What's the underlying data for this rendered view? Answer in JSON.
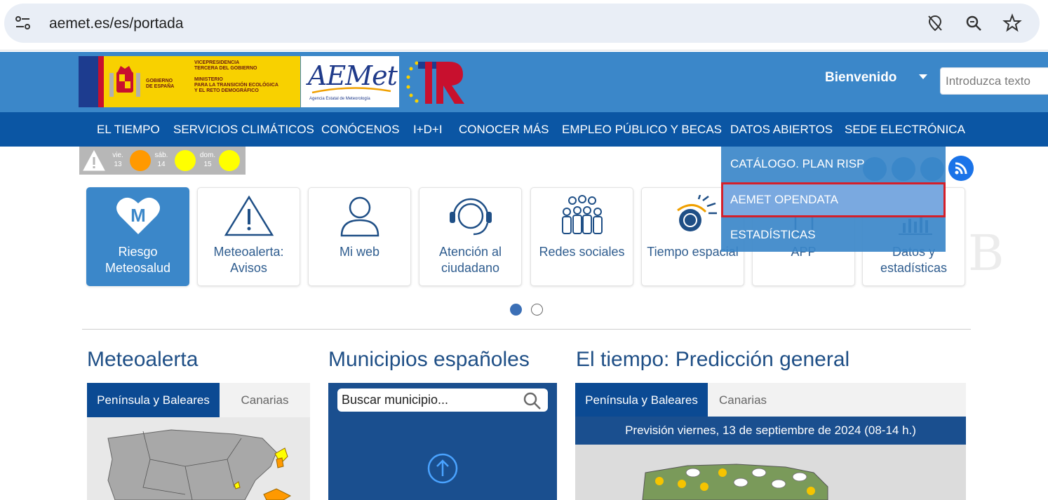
{
  "browser": {
    "url": "aemet.es/es/portada",
    "icons": [
      "site-info-icon",
      "location-blocked-icon",
      "zoom-icon",
      "bookmark-star-icon"
    ]
  },
  "header": {
    "gov_logo_text_left": "GOBIERNO\nDE ESPAÑA",
    "gov_logo_text_right": "VICEPRESIDENCIA\nTERCERA DEL GOBIERNO\n\nMINISTERIO\nPARA LA TRANSICIÓN ECOLÓGICA\nY EL RETO DEMOGRÁFICO",
    "aemet_logo_word": "AEMet",
    "aemet_logo_sub": "Agencia Estatal de Meteorología",
    "welcome": "Bienvenido",
    "search_placeholder": "Introduzca texto"
  },
  "nav": {
    "items": [
      "EL TIEMPO",
      "SERVICIOS CLIMÁTICOS",
      "CONÓCENOS",
      "I+D+I",
      "CONOCER MÁS",
      "EMPLEO PÚBLICO Y BECAS",
      "DATOS ABIERTOS",
      "SEDE ELECTRÓNICA"
    ]
  },
  "warnings": {
    "days": [
      {
        "day": "vie.",
        "num": "13",
        "color": "#ff9900"
      },
      {
        "day": "sáb.",
        "num": "14",
        "color": "#ffff00"
      },
      {
        "day": "dom.",
        "num": "15",
        "color": "#ffff00"
      }
    ]
  },
  "dropdown": {
    "items": [
      "CATÁLOGO. PLAN RISP",
      "AEMET OPENDATA",
      "ESTADÍSTICAS"
    ],
    "highlighted_index": 1
  },
  "cards": [
    {
      "label": "Riesgo Meteosalud",
      "icon": "heart-m-icon",
      "active": true
    },
    {
      "label": "Meteoalerta: Avisos",
      "icon": "warning-triangle-icon",
      "active": false
    },
    {
      "label": "Mi web",
      "icon": "user-icon",
      "active": false
    },
    {
      "label": "Atención al ciudadano",
      "icon": "headset-icon",
      "active": false
    },
    {
      "label": "Redes sociales",
      "icon": "people-group-icon",
      "active": false
    },
    {
      "label": "Tiempo espacial",
      "icon": "space-weather-icon",
      "active": false
    },
    {
      "label": "APP",
      "icon": "phone-icon",
      "active": false
    },
    {
      "label": "Datos y estadísticas",
      "icon": "bar-chart-icon",
      "active": false
    }
  ],
  "sections": {
    "meteoalerta": {
      "title": "Meteoalerta",
      "tabs": [
        "Península y Baleares",
        "Canarias"
      ]
    },
    "municipios": {
      "title": "Municipios españoles",
      "search_placeholder": "Buscar municipio..."
    },
    "prediccion": {
      "title": "El tiempo: Predicción general",
      "tabs": [
        "Península y Baleares",
        "Canarias"
      ],
      "caption": "Previsión viernes, 13 de septiembre de 2024 (08-14 h.)"
    }
  },
  "colors": {
    "header_blue": "#3b87c9",
    "nav_blue": "#0b56a4",
    "dark_blue": "#1a4f8f",
    "highlight_red": "#d41f2a"
  }
}
